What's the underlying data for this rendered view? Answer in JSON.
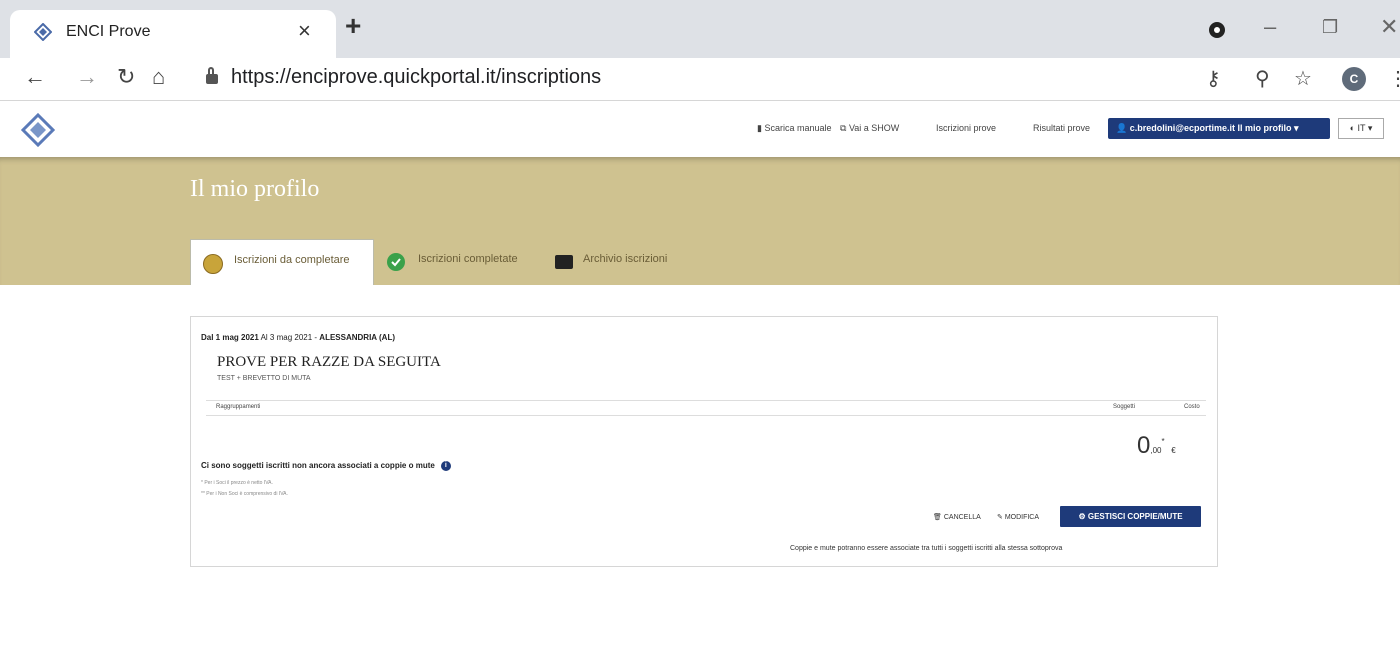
{
  "browser": {
    "tab_title": "ENCI Prove",
    "tab_close": "×",
    "new_tab": "+",
    "url": "https://enciprove.quickportal.it/inscriptions",
    "avatar_letter": "C"
  },
  "header": {
    "nav_links": {
      "manual": "Scarica manuale",
      "show": "Vai a SHOW",
      "inscriptions": "Iscrizioni prove",
      "results": "Risultati prove"
    },
    "user_button": "c.bredolini@ecportime.it  Il mio profilo ▾",
    "language": "IT ▾"
  },
  "profile": {
    "title": "Il mio profilo",
    "tabs": [
      {
        "label": "Iscrizioni da completare",
        "active": true
      },
      {
        "label": "Iscrizioni completate",
        "active": false
      },
      {
        "label": "Archivio iscrizioni",
        "active": false
      }
    ]
  },
  "event": {
    "date_prefix": "Dal 1 mag 2021",
    "date_to": " Al 3 mag 2021 - ",
    "location": "ALESSANDRIA (AL)",
    "title": "PROVE PER RAZZE DA SEGUITA",
    "subtitle": "TEST + BREVETTO DI MUTA",
    "table_headers": {
      "group": "Raggruppamenti",
      "subjects": "Soggetti",
      "cost": "Costo"
    },
    "total_int": "0",
    "total_dec": ",00",
    "total_sup": "*",
    "total_currency": "€",
    "alert": "Ci sono soggetti iscritti non ancora associati a coppie o mute",
    "notes": [
      "* Per i Soci il prezzo è netto IVA.",
      "** Per i Non Soci è comprensivo di IVA."
    ],
    "actions": {
      "delete": "CANCELLA",
      "edit": "MODIFICA",
      "manage": "GESTISCI COPPIE/MUTE"
    },
    "footer_note": "Coppie e mute potranno essere associate tra tutti i soggetti iscritti alla stessa sottoprova"
  },
  "colors": {
    "brand_blue": "#1e3a7a",
    "gold_band": "#cfc290",
    "pending": "#c8a43a",
    "completed": "#3aa14a"
  }
}
